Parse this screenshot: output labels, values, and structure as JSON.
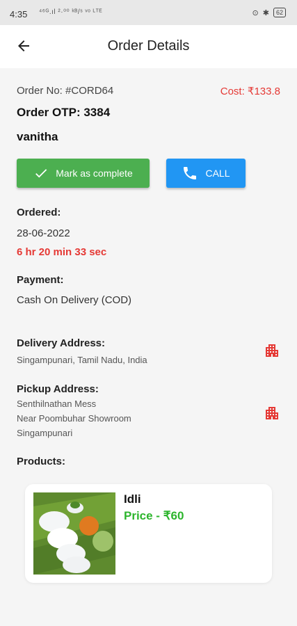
{
  "status_bar": {
    "time": "4:35",
    "network": "⁴⁶ᴳ.ıl ²·⁰⁰ ᵏᴮ/ˢ ᵛᵒ ᴸᵀᴱ",
    "battery": "62"
  },
  "header": {
    "title": "Order Details"
  },
  "order": {
    "order_no": "Order No: #CORD64",
    "cost": "Cost: ₹133.8",
    "otp": "Order OTP: 3384",
    "customer": "vanitha"
  },
  "actions": {
    "complete_label": "Mark as complete",
    "call_label": "CALL"
  },
  "ordered": {
    "label": "Ordered:",
    "date": "28-06-2022",
    "elapsed": "6 hr 20 min 33 sec"
  },
  "payment": {
    "label": "Payment:",
    "method": "Cash On Delivery (COD)"
  },
  "delivery": {
    "label": "Delivery Address:",
    "address": "Singampunari, Tamil Nadu, India"
  },
  "pickup": {
    "label": "Pickup Address:",
    "line1": "Senthilnathan Mess",
    "line2": "Near Poombuhar Showroom",
    "line3": "Singampunari"
  },
  "products": {
    "label": "Products:",
    "items": [
      {
        "name": "Idli",
        "price": "Price - ₹60"
      }
    ]
  },
  "colors": {
    "complete_button": "#4caf50",
    "call_button": "#2196f3",
    "accent_red": "#e53935",
    "price_green": "#2db52d"
  },
  "icons": [
    "back-arrow-icon",
    "checkmark-icon",
    "phone-icon",
    "building-icon"
  ]
}
